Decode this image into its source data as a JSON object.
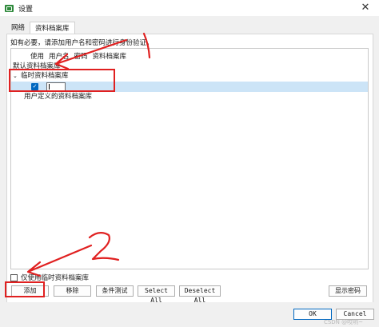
{
  "window": {
    "title": "设置",
    "close_glyph": "✕"
  },
  "tabs": [
    {
      "label": "网络",
      "active": false
    },
    {
      "label": "资料档案库",
      "active": true
    }
  ],
  "hint": "如有必要，请添加用户名和密码进行身份验证。",
  "tree": {
    "columns": [
      "使用",
      "用户名",
      "密码",
      "资料档案库"
    ],
    "default_repo": "默认资料档案库",
    "temp_repo": "临时资料档案库",
    "user_repo": "用户定义的资料档案库",
    "entry": {
      "checked": "✓",
      "value": ""
    }
  },
  "only_temp_label": "仅使用临时资料档案库",
  "buttons": {
    "add": "添加",
    "remove": "移除",
    "test": "条件测试",
    "select_all": "Select All",
    "deselect_all": "Deselect All",
    "show_password": "显示密码",
    "ok": "OK",
    "cancel": "Cancel"
  },
  "annotations": {
    "num1": "1",
    "num2": "2",
    "color": "#e02020"
  },
  "watermark": "CSDN @哎哟~",
  "colors": {
    "selection": "#cce4f7",
    "checkbox": "#0067c0",
    "annotation": "#e02020"
  }
}
